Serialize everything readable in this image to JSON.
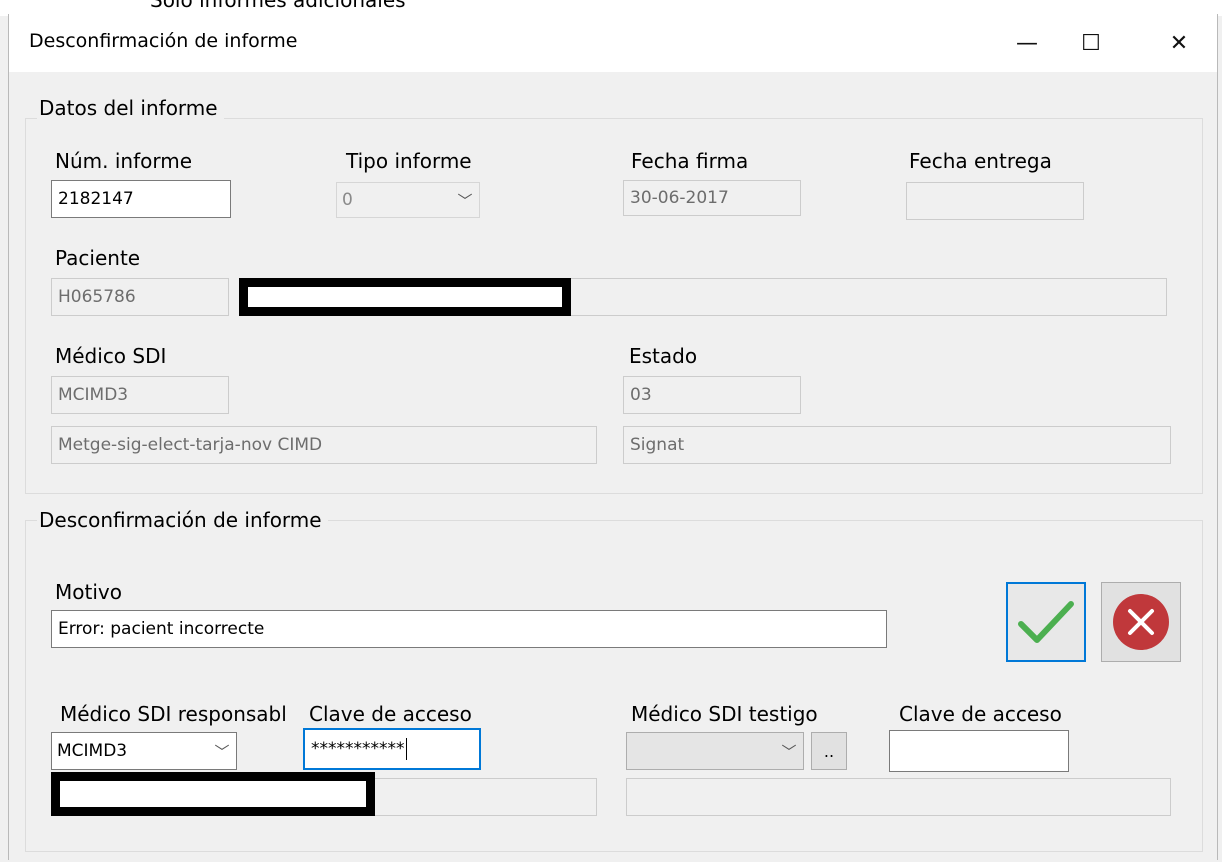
{
  "background": {
    "partial_text": "Solo informes adicionales"
  },
  "window": {
    "title": "Desconfirmación de informe",
    "controls": {
      "minimize": "—",
      "maximize": "☐",
      "close": "✕"
    }
  },
  "datos": {
    "group_label": "Datos del informe",
    "num_informe": {
      "label": "Núm. informe",
      "value": "2182147"
    },
    "tipo_informe": {
      "label": "Tipo informe",
      "value": "0"
    },
    "fecha_firma": {
      "label": "Fecha firma",
      "value": "30-06-2017"
    },
    "fecha_entrega": {
      "label": "Fecha entrega",
      "value": ""
    },
    "paciente": {
      "label": "Paciente",
      "code": "H065786",
      "name": ""
    },
    "medico": {
      "label": "Médico SDI",
      "code": "MCIMD3",
      "name": "Metge-sig-elect-tarja-nov CIMD"
    },
    "estado": {
      "label": "Estado",
      "code": "03",
      "desc": "Signat"
    }
  },
  "desconf": {
    "group_label": "Desconfirmación de informe",
    "motivo": {
      "label": "Motivo",
      "value": "Error: pacient incorrecte"
    },
    "medico_resp": {
      "label": "Médico SDI responsabl",
      "value": "MCIMD3",
      "name": ""
    },
    "clave_resp": {
      "label": "Clave de acceso",
      "value": "***********"
    },
    "medico_testigo": {
      "label": "Médico SDI testigo",
      "value": "",
      "browse": "..",
      "name": ""
    },
    "clave_testigo": {
      "label": "Clave de acceso",
      "value": ""
    }
  },
  "colors": {
    "accept_border": "#0078d7",
    "accept_check": "#4caf50",
    "cancel_circle": "#c0383b"
  },
  "icons": {
    "accept": "checkmark-icon",
    "cancel": "close-circle-icon"
  }
}
